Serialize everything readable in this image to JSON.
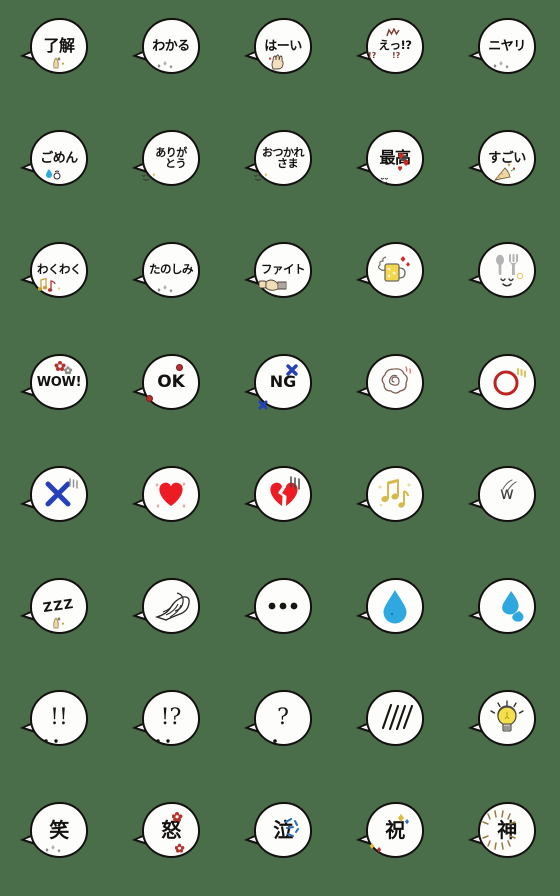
{
  "page": {
    "background_color": "#4a6d4a",
    "bubble_fill": "#fdfdfc",
    "bubble_outline": "#13110f",
    "grid_columns": 5,
    "grid_rows": 8,
    "total_stickers": 40
  },
  "stickers": [
    {
      "id": 1,
      "label": "了解",
      "kind": "text",
      "size": "t-2",
      "deco": "sparkle-beige"
    },
    {
      "id": 2,
      "label": "わかる",
      "kind": "text",
      "size": "t-3",
      "deco": "sparkle-gray"
    },
    {
      "id": 3,
      "label": "はーい",
      "kind": "text",
      "size": "t-3",
      "deco": "raised-hand"
    },
    {
      "id": 4,
      "label": "えっ!?",
      "kind": "text",
      "size": "t-4",
      "deco": "exclaim-question-marks"
    },
    {
      "id": 5,
      "label": "ニヤリ",
      "kind": "text",
      "size": "t-3",
      "deco": "sparkle-gray"
    },
    {
      "id": 6,
      "label": "ごめん",
      "kind": "text",
      "size": "t-3",
      "deco": "blue-teardrop"
    },
    {
      "id": 7,
      "label": "ありがとう",
      "kind": "text2",
      "line1": "ありが",
      "line2": "とう",
      "deco": "small-face"
    },
    {
      "id": 8,
      "label": "おつかれさま",
      "kind": "text2",
      "line1": "おつかれ",
      "line2": "さま",
      "deco": "small-face"
    },
    {
      "id": 9,
      "label": "最高",
      "kind": "text",
      "size": "t-2",
      "deco": "red-hearts"
    },
    {
      "id": 10,
      "label": "すごい",
      "kind": "text",
      "size": "t-3",
      "deco": "party-popper"
    },
    {
      "id": 11,
      "label": "わくわく",
      "kind": "text",
      "size": "t-4",
      "deco": "music-notes"
    },
    {
      "id": 12,
      "label": "たのしみ",
      "kind": "text",
      "size": "t-4",
      "deco": "sparkle-gray"
    },
    {
      "id": 13,
      "label": "ファイト",
      "kind": "text",
      "size": "t-4",
      "deco": "muscle-arm"
    },
    {
      "id": 14,
      "label": "ビール",
      "kind": "icon",
      "icon": "beer-mug-icon"
    },
    {
      "id": 15,
      "label": "食事",
      "kind": "icon",
      "icon": "spoon-fork-icon"
    },
    {
      "id": 16,
      "label": "WOW!",
      "kind": "latin",
      "size": "l-wow",
      "deco": "red-flower-dots"
    },
    {
      "id": 17,
      "label": "OK",
      "kind": "latin",
      "size": "l-ok",
      "deco": "red-dots"
    },
    {
      "id": 18,
      "label": "NG",
      "kind": "latin",
      "size": "l-ng",
      "deco": "blue-x-marks"
    },
    {
      "id": 19,
      "label": "バラ",
      "kind": "icon",
      "icon": "rose-icon"
    },
    {
      "id": 20,
      "label": "○",
      "kind": "icon",
      "icon": "red-circle-icon"
    },
    {
      "id": 21,
      "label": "✕",
      "kind": "icon",
      "icon": "blue-cross-icon"
    },
    {
      "id": 22,
      "label": "ハート",
      "kind": "icon",
      "icon": "red-heart-icon"
    },
    {
      "id": 23,
      "label": "失恋",
      "kind": "icon",
      "icon": "broken-heart-icon"
    },
    {
      "id": 24,
      "label": "音符",
      "kind": "icon",
      "icon": "music-note-icon"
    },
    {
      "id": 25,
      "label": "w",
      "kind": "latin",
      "size": "l-w",
      "deco": "sweat-lines"
    },
    {
      "id": 26,
      "label": "ZZZ",
      "kind": "latin",
      "size": "l-zzz",
      "deco": "sparkle-beige"
    },
    {
      "id": 27,
      "label": "ほら貝",
      "kind": "icon",
      "icon": "conch-shell-icon"
    },
    {
      "id": 28,
      "label": "・・・",
      "kind": "icon",
      "icon": "three-dots-icon"
    },
    {
      "id": 29,
      "label": "汗",
      "kind": "icon",
      "icon": "water-drop-icon"
    },
    {
      "id": 30,
      "label": "汗2",
      "kind": "icon",
      "icon": "two-drops-icon"
    },
    {
      "id": 31,
      "label": "!!",
      "kind": "punct",
      "size": "punct",
      "deco": "face-dots"
    },
    {
      "id": 32,
      "label": "!?",
      "kind": "punct",
      "size": "punct",
      "deco": "face-dots"
    },
    {
      "id": 33,
      "label": "?",
      "kind": "punct",
      "size": "punct",
      "deco": "face-dot"
    },
    {
      "id": 34,
      "label": "////",
      "kind": "icon",
      "icon": "blush-lines-icon"
    },
    {
      "id": 35,
      "label": "ひらめき",
      "kind": "icon",
      "icon": "light-bulb-icon"
    },
    {
      "id": 36,
      "label": "笑",
      "kind": "text",
      "size": "t-big",
      "deco": "sparkle-gray"
    },
    {
      "id": 37,
      "label": "怒",
      "kind": "text",
      "size": "t-big",
      "deco": "anger-marks"
    },
    {
      "id": 38,
      "label": "泣",
      "kind": "text",
      "size": "t-big",
      "deco": "blue-splash"
    },
    {
      "id": 39,
      "label": "祝",
      "kind": "text",
      "size": "t-big",
      "deco": "confetti"
    },
    {
      "id": 40,
      "label": "神",
      "kind": "text",
      "size": "t-big",
      "deco": "radiant-rays"
    }
  ]
}
